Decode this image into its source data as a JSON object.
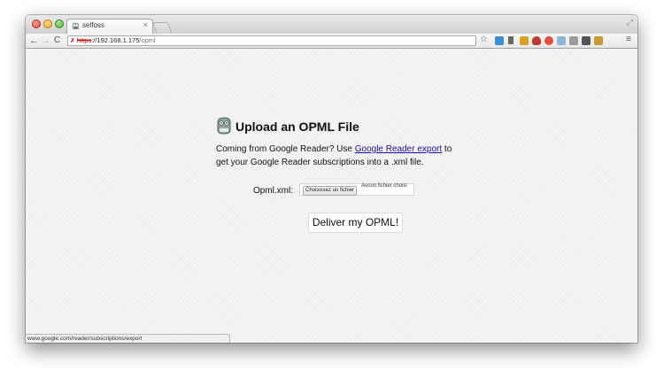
{
  "browser": {
    "tab_title": "selfoss",
    "tab_close": "×",
    "url": {
      "scheme": "https",
      "separator": "://",
      "host": "192.168.1.175",
      "path": "/opml"
    },
    "status_url": "www.google.com/reader/subscriptions/export",
    "colors": {
      "traffic_close": "#e0443e",
      "traffic_minimize": "#e0a32a",
      "traffic_maximize": "#4cae3a",
      "insecure_scheme": "#cc0000"
    },
    "icons": {
      "back": "←",
      "forward": "→",
      "reload": "C",
      "star": "☆",
      "menu": "≡",
      "fullscreen": "⤢"
    }
  },
  "page": {
    "heading": "Upload an OPML File",
    "intro_before": "Coming from Google Reader? Use ",
    "intro_link": "Google Reader export",
    "intro_after": " to get your Google Reader subscriptions into a .xml file.",
    "file_label": "Opml.xml:",
    "choose_button": "Choisissez un fichier",
    "no_file_text": "Aucun fichier choisi",
    "submit_button": "Deliver my OPML!",
    "link_color": "#1a0dab"
  }
}
